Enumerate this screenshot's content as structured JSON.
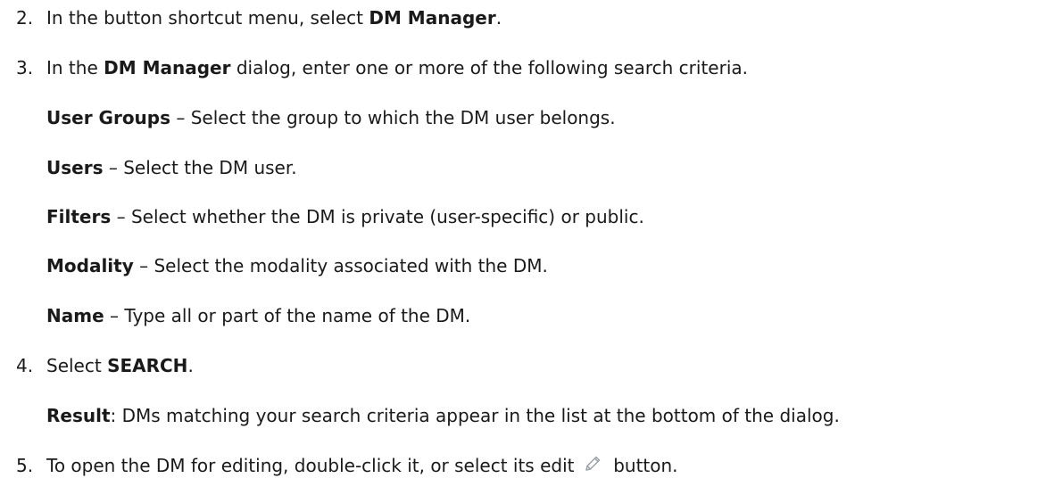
{
  "steps": [
    {
      "number": "2.",
      "parts": [
        {
          "text": "In the button shortcut menu, select "
        },
        {
          "text": "DM Manager",
          "bold": true
        },
        {
          "text": "."
        }
      ]
    },
    {
      "number": "3.",
      "parts": [
        {
          "text": "In the "
        },
        {
          "text": "DM Manager",
          "bold": true
        },
        {
          "text": " dialog, enter one or more of the following search criteria."
        }
      ]
    },
    {
      "number": "",
      "parts": [
        {
          "text": "User Groups",
          "bold": true
        },
        {
          "text": " – Select the group to which the DM user belongs."
        }
      ]
    },
    {
      "number": "",
      "parts": [
        {
          "text": "Users",
          "bold": true
        },
        {
          "text": " – Select the DM user."
        }
      ]
    },
    {
      "number": "",
      "parts": [
        {
          "text": "Filters",
          "bold": true
        },
        {
          "text": " – Select whether the DM is private (user-specific) or public."
        }
      ]
    },
    {
      "number": "",
      "parts": [
        {
          "text": "Modality",
          "bold": true
        },
        {
          "text": " – Select the modality associated with the DM."
        }
      ]
    },
    {
      "number": "",
      "parts": [
        {
          "text": "Name",
          "bold": true
        },
        {
          "text": " – Type all or part of the name of the DM."
        }
      ]
    },
    {
      "number": "4.",
      "parts": [
        {
          "text": "Select "
        },
        {
          "text": "SEARCH",
          "bold": true
        },
        {
          "text": "."
        }
      ]
    },
    {
      "number": "",
      "parts": [
        {
          "text": "Result",
          "bold": true
        },
        {
          "text": ": DMs matching your search criteria appear in the list at the bottom of the dialog."
        }
      ]
    },
    {
      "number": "5.",
      "parts": [
        {
          "text": "To open the DM for editing, double-click it, or select its edit "
        },
        {
          "icon": "pencil-edit-icon"
        },
        {
          "text": " button."
        }
      ]
    }
  ],
  "colors": {
    "text": "#1a1a1a",
    "icon_stroke": "#9aa0a6"
  }
}
